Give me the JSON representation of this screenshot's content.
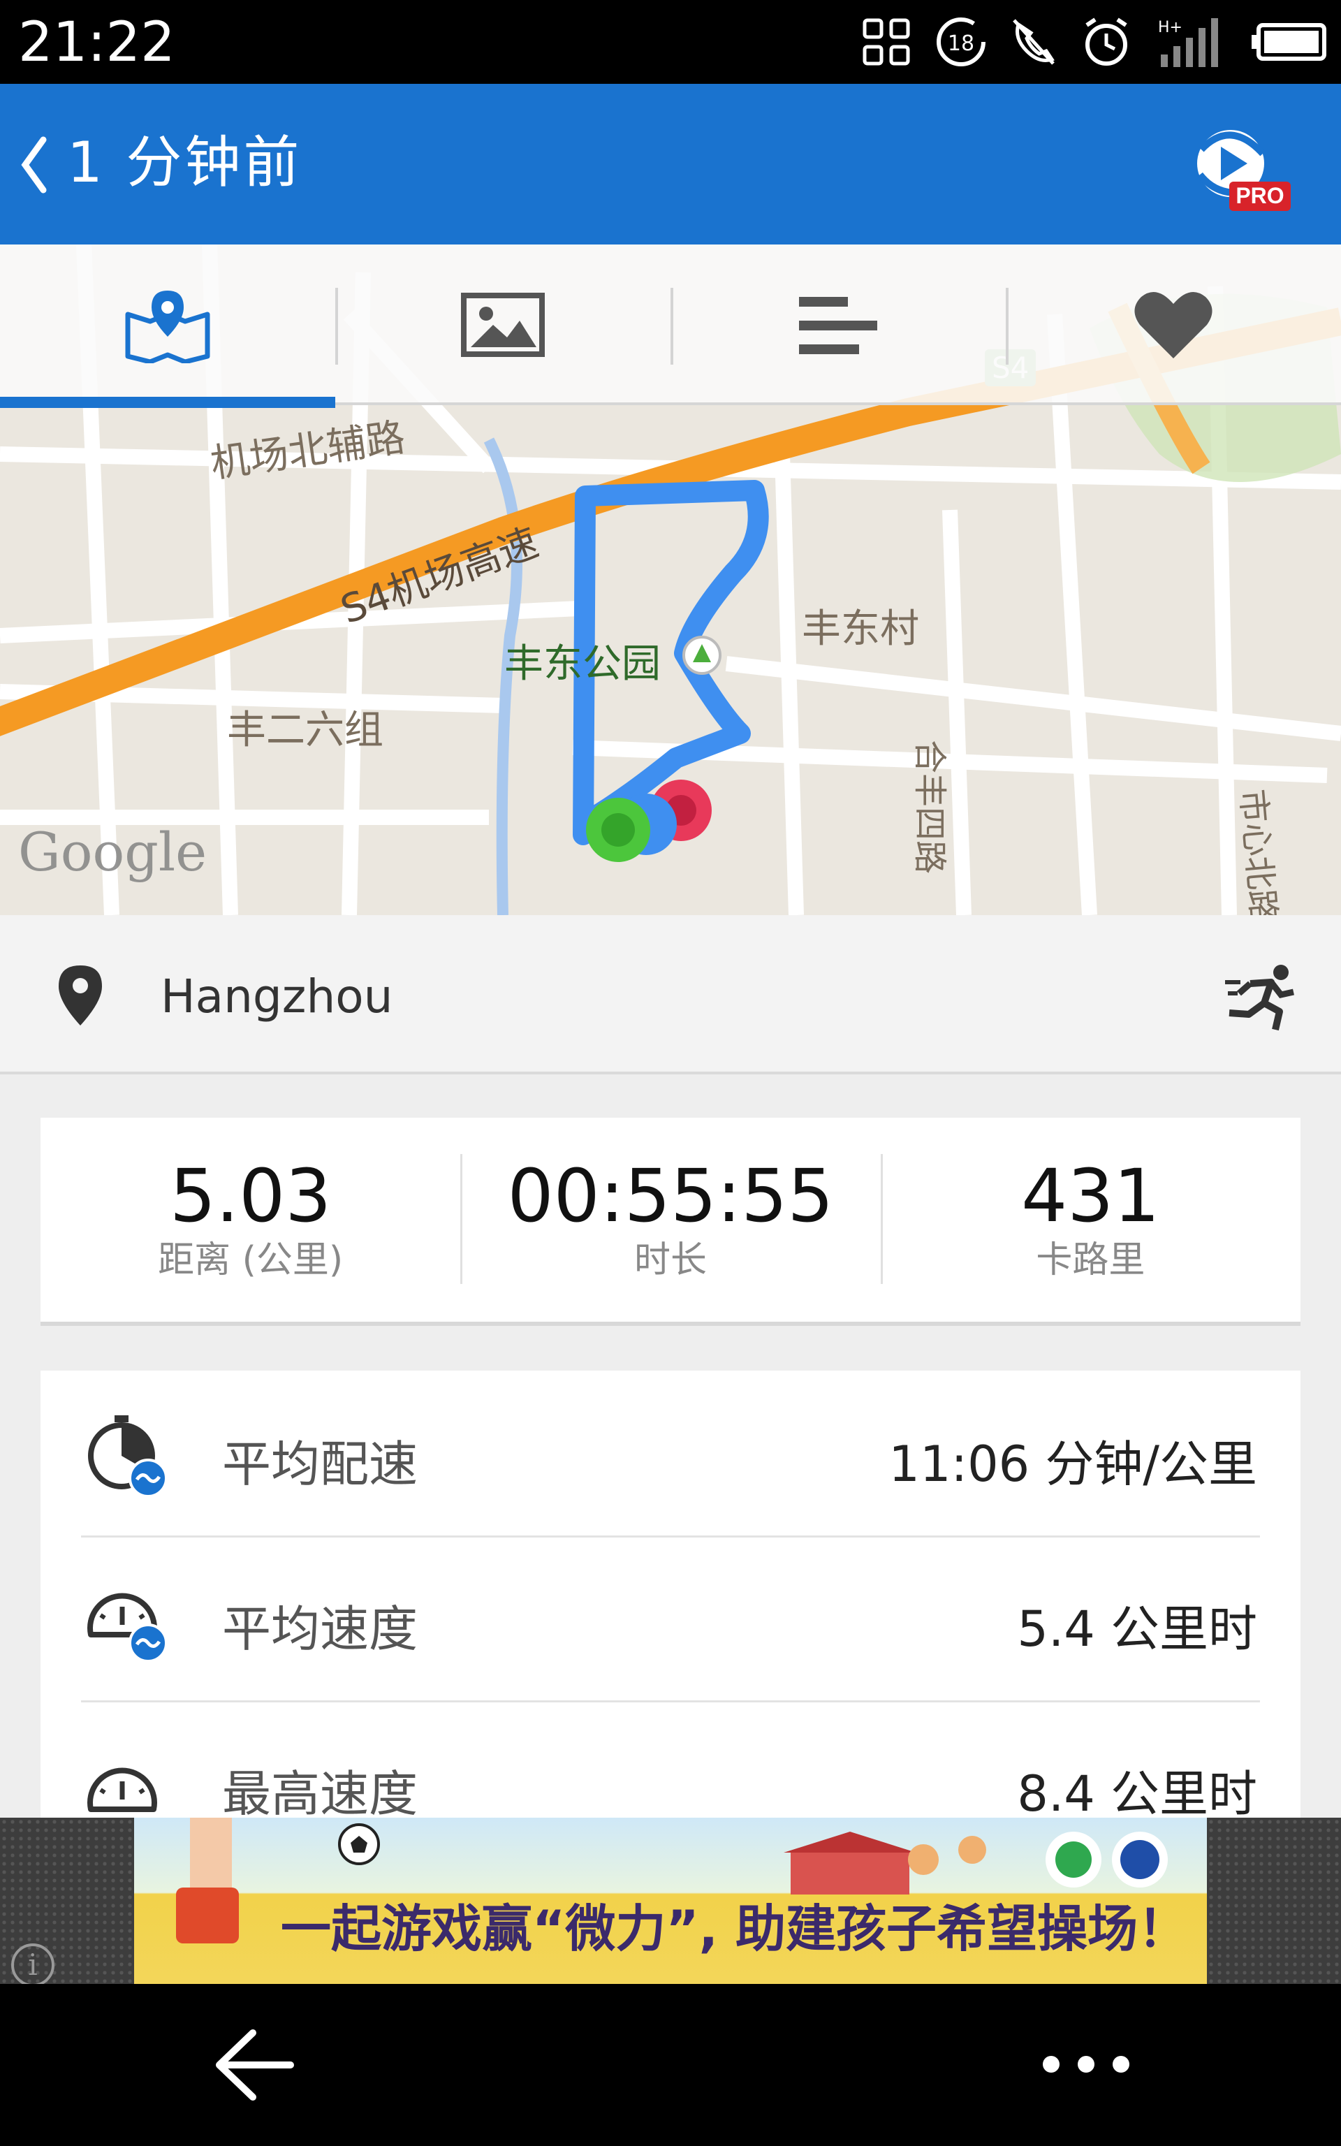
{
  "status_bar": {
    "time": "21:22",
    "signal_label": "H+",
    "notification_count": "18"
  },
  "header": {
    "title": "1 分钟前",
    "badge": "PRO"
  },
  "tabs": [
    {
      "icon": "map-pin-icon",
      "active": true
    },
    {
      "icon": "image-icon",
      "active": false
    },
    {
      "icon": "bar-list-icon",
      "active": false
    },
    {
      "icon": "heart-icon",
      "active": false
    }
  ],
  "map": {
    "labels": [
      "机场北辅路",
      "S4机场高速",
      "丰东公园",
      "丰东村",
      "丰二六组",
      "合丰四路",
      "市心北路",
      "S4"
    ],
    "attribution": "Google"
  },
  "location": {
    "city": "Hangzhou"
  },
  "stats": [
    {
      "value": "5.03",
      "label": "距离 (公里)"
    },
    {
      "value": "00:55:55",
      "label": "时长"
    },
    {
      "value": "431",
      "label": "卡路里"
    }
  ],
  "details": [
    {
      "icon": "pace-icon",
      "label": "平均配速",
      "value": "11:06 分钟/公里"
    },
    {
      "icon": "speed-icon",
      "label": "平均速度",
      "value": "5.4 公里时"
    },
    {
      "icon": "max-speed-icon",
      "label": "最高速度",
      "value": "8.4 公里时"
    }
  ],
  "ad": {
    "slogan": "一起游戏赢“微力”, 助建孩子希望操场！"
  },
  "colors": {
    "accent": "#1a73cf",
    "route": "#3f8ff0",
    "highway": "#f59a23",
    "start": "#4cc63c",
    "end": "#e8395a"
  }
}
